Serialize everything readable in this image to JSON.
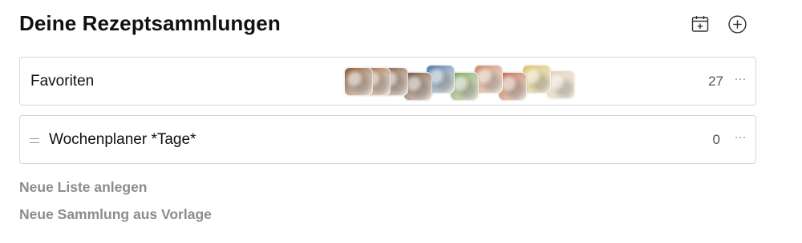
{
  "header": {
    "title": "Deine Rezeptsammlungen"
  },
  "collections": [
    {
      "name": "Favoriten",
      "count": "27",
      "more": "···",
      "thumbnails": [
        {
          "icon": "food-photo-icon",
          "color": "#8a5a3a"
        },
        {
          "icon": "food-photo-icon",
          "color": "#9b6a44"
        },
        {
          "icon": "food-photo-icon",
          "color": "#7a5238"
        },
        {
          "icon": "food-photo-icon",
          "color": "#6e4a3a"
        },
        {
          "icon": "food-photo-icon",
          "color": "#4f7aa8"
        },
        {
          "icon": "food-photo-icon",
          "color": "#7aa35a"
        },
        {
          "icon": "food-photo-icon",
          "color": "#c98b6a"
        },
        {
          "icon": "food-photo-icon",
          "color": "#b96b4f"
        },
        {
          "icon": "food-photo-icon",
          "color": "#d9c56b"
        },
        {
          "icon": "food-photo-icon",
          "color": "#e4d2b8"
        }
      ]
    },
    {
      "name": "Wochenplaner *Tage*",
      "count": "0",
      "more": "···"
    }
  ],
  "actions": {
    "new_list": "Neue Liste anlegen",
    "new_from_template": "Neue Sammlung aus Vorlage"
  },
  "colors": {
    "border": "#d6d6d6",
    "muted_text": "#8c8c8c",
    "title": "#111111"
  }
}
